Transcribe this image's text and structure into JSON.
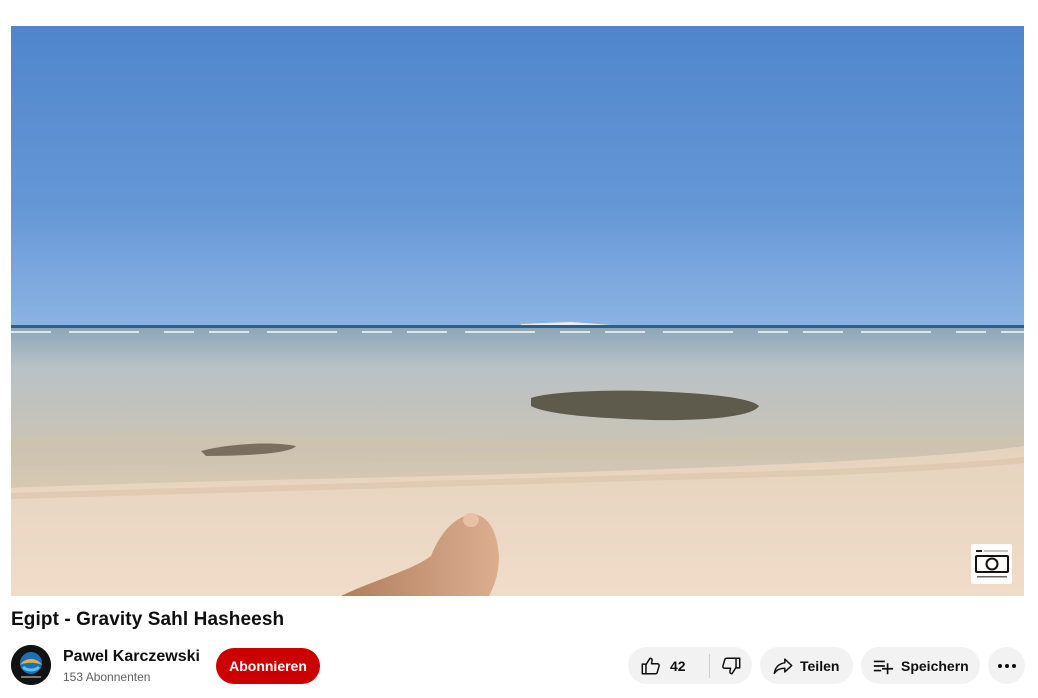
{
  "video": {
    "title": "Egipt - Gravity Sahl Hasheesh"
  },
  "channel": {
    "name": "Pawel Karczewski",
    "subscribers": "153 Abonnenten",
    "avatar_icon": "channel-avatar-logo"
  },
  "subscribe": {
    "label": "Abonnieren",
    "color": "#cc0000"
  },
  "actions": {
    "like_count": "42",
    "like_icon": "thumbs-up-icon",
    "dislike_icon": "thumbs-down-icon",
    "share_label": "Teilen",
    "share_icon": "share-arrow-icon",
    "save_label": "Speichern",
    "save_icon": "playlist-add-icon",
    "more_icon": "more-horizontal-icon"
  },
  "colors": {
    "pill_background": "#f2f2f2",
    "text_primary": "#0f0f0f",
    "text_secondary": "#606060"
  }
}
